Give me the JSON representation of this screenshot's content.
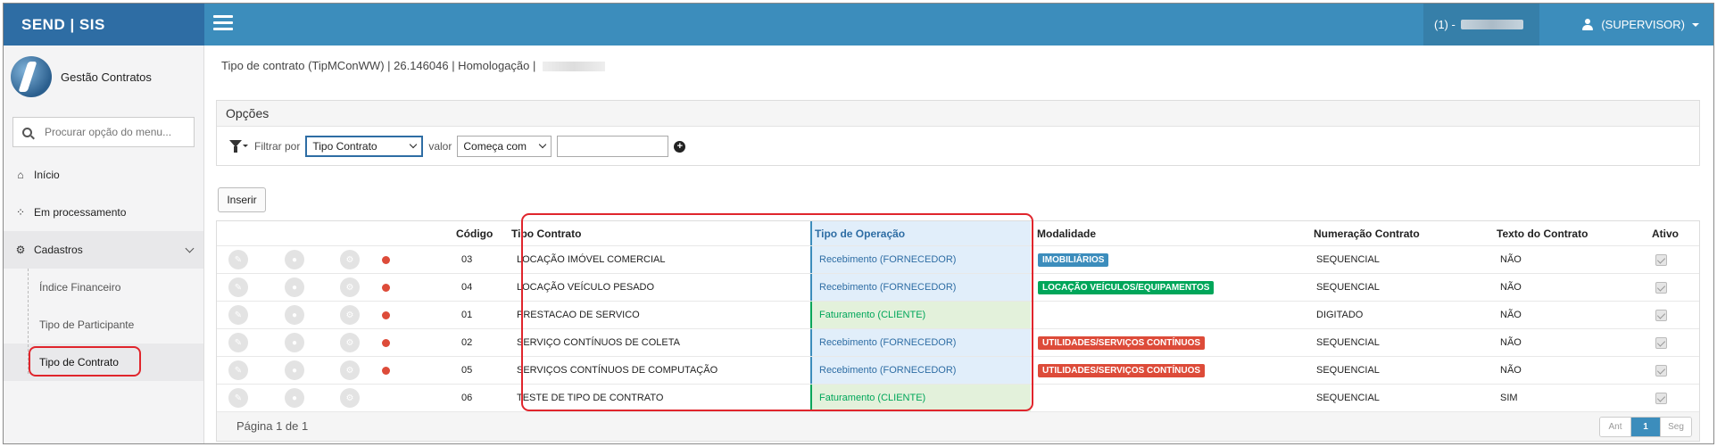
{
  "header": {
    "brand": "SEND | SIS",
    "environment_prefix": "(1) -",
    "user": "(SUPERVISOR)"
  },
  "sidebar": {
    "title": "Gestão Contratos",
    "search_placeholder": "Procurar opção do menu...",
    "items": [
      {
        "label": "Início",
        "icon": "home-icon"
      },
      {
        "label": "Em processamento",
        "icon": "spinner-icon"
      },
      {
        "label": "Cadastros",
        "icon": "cogs-icon"
      }
    ],
    "subitems": [
      {
        "label": "Índice Financeiro"
      },
      {
        "label": "Tipo de Participante"
      },
      {
        "label": "Tipo de Contrato"
      }
    ]
  },
  "page": {
    "breadcrumb": "Tipo de contrato (TipMConWW) | 26.146046 | Homologação |"
  },
  "options": {
    "title": "Opções",
    "filter_label": "Filtrar por",
    "filter_field": "Tipo Contrato",
    "value_label": "valor",
    "operator": "Começa com",
    "value": ""
  },
  "actions": {
    "insert": "Inserir"
  },
  "table": {
    "columns": {
      "codigo": "Código",
      "tipo_contrato": "Tipo Contrato",
      "tipo_operacao": "Tipo de Operação",
      "modalidade": "Modalidade",
      "numeracao": "Numeração Contrato",
      "texto": "Texto do Contrato",
      "ativo": "Ativo"
    },
    "rows": [
      {
        "codigo": "03",
        "tipo": "LOCAÇÃO IMÓVEL COMERCIAL",
        "operacao": "Recebimento (FORNECEDOR)",
        "modalidade": "IMOBILIÁRIOS",
        "numeracao": "SEQUENCIAL",
        "texto": "NÃO"
      },
      {
        "codigo": "04",
        "tipo": "LOCAÇÃO VEÍCULO PESADO",
        "operacao": "Recebimento (FORNECEDOR)",
        "modalidade": "LOCAÇÃO VEÍCULOS/EQUIPAMENTOS",
        "numeracao": "SEQUENCIAL",
        "texto": "NÃO"
      },
      {
        "codigo": "01",
        "tipo": "PRESTACAO DE SERVICO",
        "operacao": "Faturamento (CLIENTE)",
        "modalidade": "",
        "numeracao": "DIGITADO",
        "texto": "NÃO"
      },
      {
        "codigo": "02",
        "tipo": "SERVIÇO CONTÍNUOS DE COLETA",
        "operacao": "Recebimento (FORNECEDOR)",
        "modalidade": "UTILIDADES/SERVIÇOS CONTÍNUOS",
        "numeracao": "SEQUENCIAL",
        "texto": "NÃO"
      },
      {
        "codigo": "05",
        "tipo": "SERVIÇOS CONTÍNUOS DE COMPUTAÇÃO",
        "operacao": "Recebimento (FORNECEDOR)",
        "modalidade": "UTILIDADES/SERVIÇOS CONTÍNUOS",
        "numeracao": "SEQUENCIAL",
        "texto": "NÃO"
      },
      {
        "codigo": "06",
        "tipo": "TESTE DE TIPO DE CONTRATO",
        "operacao": "Faturamento (CLIENTE)",
        "modalidade": "",
        "numeracao": "SEQUENCIAL",
        "texto": "SIM"
      }
    ],
    "pagination_text": "Página 1 de 1",
    "pager": {
      "prev": "Ant",
      "current": "1",
      "next": "Seg"
    }
  },
  "colors": {
    "brand": "#2e6da4",
    "topbar": "#3c8dbc",
    "badge_blue": "#3c8dbc",
    "badge_green": "#00a65a",
    "badge_red": "#dd4b39",
    "recebimento_bg": "#e1eefa",
    "faturamento_bg": "#e3f1db",
    "highlight": "#e0252c"
  }
}
